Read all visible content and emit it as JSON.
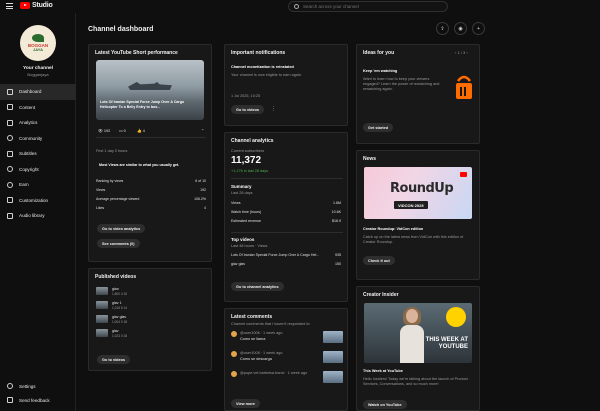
{
  "app": {
    "logo_text": "Studio",
    "search_placeholder": "Search across your channel"
  },
  "sidebar": {
    "channel_name": "Your channel",
    "channel_handle": "Bogganjaya",
    "avatar_text_1": "BOGGAN",
    "avatar_text_2": "JAYA",
    "items": [
      {
        "label": "Dashboard",
        "icon": "dashboard-icon"
      },
      {
        "label": "Content",
        "icon": "content-icon"
      },
      {
        "label": "Analytics",
        "icon": "analytics-icon"
      },
      {
        "label": "Community",
        "icon": "community-icon"
      },
      {
        "label": "Subtitles",
        "icon": "subtitles-icon"
      },
      {
        "label": "Copyright",
        "icon": "copyright-icon"
      },
      {
        "label": "Earn",
        "icon": "earn-icon"
      },
      {
        "label": "Customization",
        "icon": "customization-icon"
      },
      {
        "label": "Audio library",
        "icon": "audio-library-icon"
      }
    ],
    "bottom": [
      {
        "label": "Settings",
        "icon": "gear-icon"
      },
      {
        "label": "Send feedback",
        "icon": "feedback-icon"
      }
    ]
  },
  "main": {
    "title": "Channel dashboard",
    "short_card": {
      "title": "Latest YouTube Short performance",
      "thumb_caption": "Lots Of Iranian Special Force Jump Over A Cargo Helicopter To a Belly Entry to bos...",
      "views": "192",
      "comments": "0",
      "likes": "4",
      "first_line": "First 1 day 0 hours",
      "ranking_note": "Most Views are similar to what you usually get.",
      "stats": [
        {
          "k": "Ranking by views",
          "v": "6 of 10"
        },
        {
          "k": "Views",
          "v": "192"
        },
        {
          "k": "Average percentage viewed",
          "v": "106.2%"
        },
        {
          "k": "Likes",
          "v": "4"
        }
      ],
      "btn_analytics": "Go to video analytics",
      "btn_comments": "See comments (0)"
    },
    "published": {
      "title": "Published videos",
      "items": [
        {
          "title": "gian",
          "meta": "1,600    4    16"
        },
        {
          "title": "glav 1",
          "meta": "1,016    5    14"
        },
        {
          "title": "glav glav",
          "meta": "1,004    0    18"
        },
        {
          "title": "glav",
          "meta": "1,023    0    18"
        }
      ],
      "btn": "Go to videos"
    },
    "notifications": {
      "title": "Important notifications",
      "headline": "Channel monetization is reinstated",
      "body": "Your channel is now eligible to earn again.",
      "date": "1 Jul 2025, 10:25",
      "btn": "Go to videos"
    },
    "analytics": {
      "title": "Channel analytics",
      "subs_label": "Current subscribers",
      "subs_value": "11,372",
      "subs_delta": "+1,176 in last 28 days",
      "summary_title": "Summary",
      "summary_sub": "Last 28 days",
      "rows": [
        {
          "k": "Views",
          "v": "1.6M"
        },
        {
          "k": "Watch time (hours)",
          "v": "10.6K"
        },
        {
          "k": "Estimated revenue",
          "v": "$16.9"
        }
      ],
      "top_title": "Top videos",
      "top_sub": "Last 48 hours · Views",
      "top_rows": [
        {
          "k": "Lots Of Iranian Special Force Jump Over A Cargo Hel...",
          "v": "935"
        },
        {
          "k": "glav glav",
          "v": "150"
        }
      ],
      "btn": "Go to channel analytics"
    },
    "comments": {
      "title": "Latest comments",
      "sub": "Channel comments that I haven't responded to",
      "items": [
        {
          "author": "@user1006 · 1 week ago",
          "text": "Como se llama"
        },
        {
          "author": "@user1008 · 1 week ago",
          "text": "Como se descarga"
        },
        {
          "author": "@pupe.vet.barbeisa.franci · 1 week ago",
          "text": ""
        }
      ],
      "btn": "View more"
    },
    "ideas": {
      "title": "Ideas for you",
      "pager": "1 / 3",
      "headline": "Keep 'em watching",
      "body": "Want to learn how to keep your viewers engaged? Learn the power of rewatching and rewatching again.",
      "btn": "Get started"
    },
    "news": {
      "title": "News",
      "banner_text": "RoundUp",
      "banner_badge": "VIDCON 2025",
      "headline": "Creator Roundup: VidCon edition",
      "body": "Catch up on the latest news from VidCon with this edition of Creator Roundup.",
      "btn": "Check it out"
    },
    "insider": {
      "title": "Creator Insider",
      "thumb_text": "THIS WEEK AT YOUTUBE",
      "headline": "This Week at YouTube",
      "body": "Hello Insiders! Today we're talking about the launch of Product Services, Conversations, and so much more!",
      "btn": "Watch on YouTube"
    }
  }
}
